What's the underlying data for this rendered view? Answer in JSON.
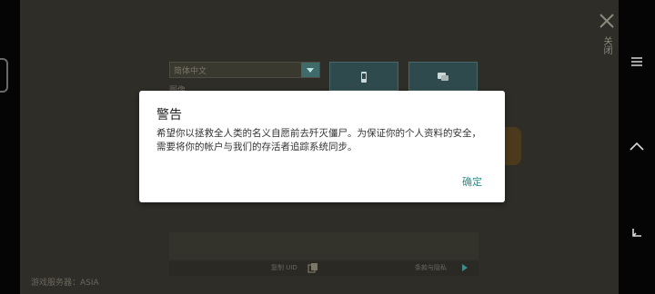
{
  "header": {
    "close_label": "关闭"
  },
  "settings": {
    "language_value": "简体中文",
    "image_label": "图像"
  },
  "footer": {
    "copy_uid_label": "复制 UID",
    "terms_label": "条款与隐私",
    "server_label": "游戏服务器：ASIA"
  },
  "dialog": {
    "title": "警告",
    "body": "希望你以拯救全人类的名义自愿前去歼灭僵尸。为保证你的个人资料的安全，需要将你的帐户与我们的存活者追踪系统同步。",
    "ok_label": "确定"
  },
  "icons": {
    "close": "close-icon",
    "phone": "phone-icon",
    "chat": "chat-icon",
    "copy": "copy-icon",
    "menu": "menu-icon",
    "home": "home-icon",
    "back": "back-icon"
  },
  "colors": {
    "accent": "#2f8c8a",
    "backdrop": "#2e2d27"
  }
}
